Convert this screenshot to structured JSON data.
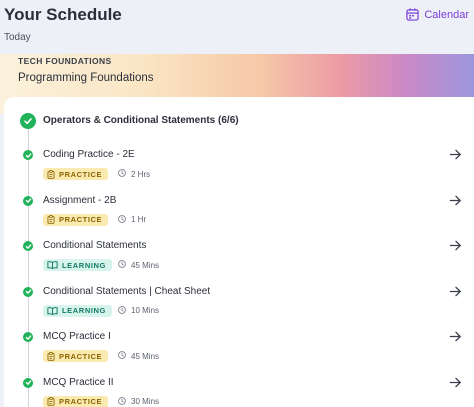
{
  "header": {
    "title": "Your Schedule",
    "calendar_label": "Calendar",
    "today_label": "Today"
  },
  "banner": {
    "kicker": "TECH FOUNDATIONS",
    "title": "Programming Foundations"
  },
  "section": {
    "title": "Operators & Conditional Statements (6/6)"
  },
  "items": [
    {
      "title": "Coding Practice - 2E",
      "type": "PRACTICE",
      "duration": "2 Hrs"
    },
    {
      "title": "Assignment - 2B",
      "type": "PRACTICE",
      "duration": "1 Hr"
    },
    {
      "title": "Conditional Statements",
      "type": "LEARNING",
      "duration": "45 Mins"
    },
    {
      "title": "Conditional Statements | Cheat Sheet",
      "type": "LEARNING",
      "duration": "10 Mins"
    },
    {
      "title": "MCQ Practice I",
      "type": "PRACTICE",
      "duration": "45 Mins"
    },
    {
      "title": "MCQ Practice II",
      "type": "PRACTICE",
      "duration": "30 Mins"
    }
  ],
  "colors": {
    "accent": "#7a3fd6",
    "success": "#22b35a",
    "practice_bg": "#fbeab0",
    "learning_bg": "#d6f4ec"
  },
  "icons": {
    "calendar": "calendar-icon",
    "completed": "check-circle-icon",
    "practice": "clipboard-icon",
    "learning": "book-open-icon",
    "duration": "clock-icon",
    "open": "arrow-right-icon"
  }
}
